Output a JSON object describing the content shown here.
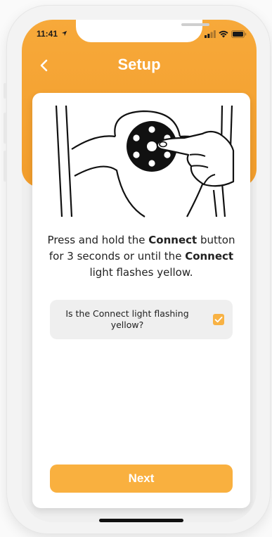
{
  "status": {
    "time": "11:41",
    "location_icon": "location-arrow-icon",
    "signal_icon": "cell-signal-icon",
    "wifi_icon": "wifi-icon",
    "battery_icon": "battery-icon"
  },
  "header": {
    "title": "Setup",
    "back_icon": "chevron-left-icon"
  },
  "instructions": {
    "line_a": "Press and hold the ",
    "bold_a": "Connect",
    "line_b": " button for 3 seconds or until the ",
    "bold_b": "Connect",
    "line_c": " light flashes yellow."
  },
  "question": {
    "text": "Is the Connect light flashing yellow?",
    "checked": true
  },
  "actions": {
    "next_label": "Next"
  },
  "colors": {
    "accent": "#F6A535",
    "button": "#F9B03F",
    "card": "#FFFFFF",
    "question_bg": "#EFEFEF"
  }
}
